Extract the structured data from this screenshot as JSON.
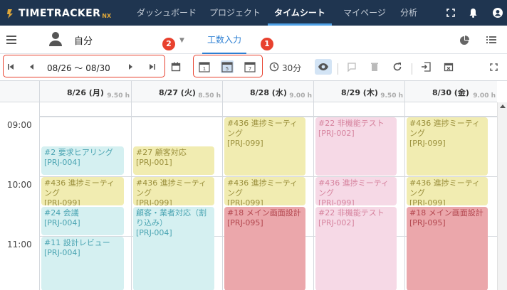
{
  "app": {
    "logo": "TIMETRACKER",
    "logo_suffix": "NX"
  },
  "nav": {
    "tabs": [
      "ダッシュボード",
      "プロジェクト",
      "タイムシート",
      "マイページ",
      "分析"
    ],
    "active_tab": "タイムシート",
    "icons": [
      "fullscreen-icon",
      "bell-icon",
      "account-icon"
    ]
  },
  "subbar": {
    "user": "自分",
    "tab": "工数入力"
  },
  "toolbar": {
    "date_range": "08/26 ～ 08/30",
    "interval": "30分",
    "badge1": "1",
    "badge2": "2",
    "cal_icons": [
      "1",
      "5",
      "7"
    ]
  },
  "calendar": {
    "days": [
      {
        "label": "8/26 (月)",
        "hours": "9.50 h"
      },
      {
        "label": "8/27 (火)",
        "hours": "8.50 h"
      },
      {
        "label": "8/28 (水)",
        "hours": "9.00 h"
      },
      {
        "label": "8/29 (木)",
        "hours": "9.50 h"
      },
      {
        "label": "8/30 (金)",
        "hours": "9.00 h"
      }
    ],
    "times": [
      "09:00",
      "10:00",
      "11:00"
    ],
    "events": {
      "d1e1": {
        "title": "#2 要求ヒアリング",
        "code": "[PRJ-004]"
      },
      "d1e2": {
        "title": "#436 進捗ミーティング",
        "code": "[PRJ-099]"
      },
      "d1e3": {
        "title": "#24 会議",
        "code": "[PRJ-004]"
      },
      "d1e4": {
        "title": "#11 設計レビュー",
        "code": "[PRJ-004]"
      },
      "d2e1": {
        "title": "#27 顧客対応",
        "code": "[PRJ-001]"
      },
      "d2e2": {
        "title": "#436 進捗ミーティング",
        "code": "[PRJ-099]"
      },
      "d2e3": {
        "title": "顧客・業者対応（割り込み）",
        "code": "[PRJ-004]"
      },
      "d3e1": {
        "title": "#436 進捗ミーティング",
        "code": "[PRJ-099]"
      },
      "d3e2": {
        "title": "#436 進捗ミーティング",
        "code": "[PRJ-099]"
      },
      "d3e3": {
        "title": "#18 メイン画面設計",
        "code": "[PRJ-095]"
      },
      "d4e1": {
        "title": "#22 非機能テスト",
        "code": "[PRJ-002]"
      },
      "d4e2": {
        "title": "#436 進捗ミーティング",
        "code": "[PRJ-099]"
      },
      "d4e3": {
        "title": "#22 非機能テスト",
        "code": "[PRJ-002]"
      },
      "d5e1": {
        "title": "#436 進捗ミーティング",
        "code": "[PRJ-099]"
      },
      "d5e2": {
        "title": "#436 進捗ミーティング",
        "code": "[PRJ-099]"
      },
      "d5e3": {
        "title": "#18 メイン画面設計",
        "code": "[PRJ-095]"
      }
    }
  }
}
